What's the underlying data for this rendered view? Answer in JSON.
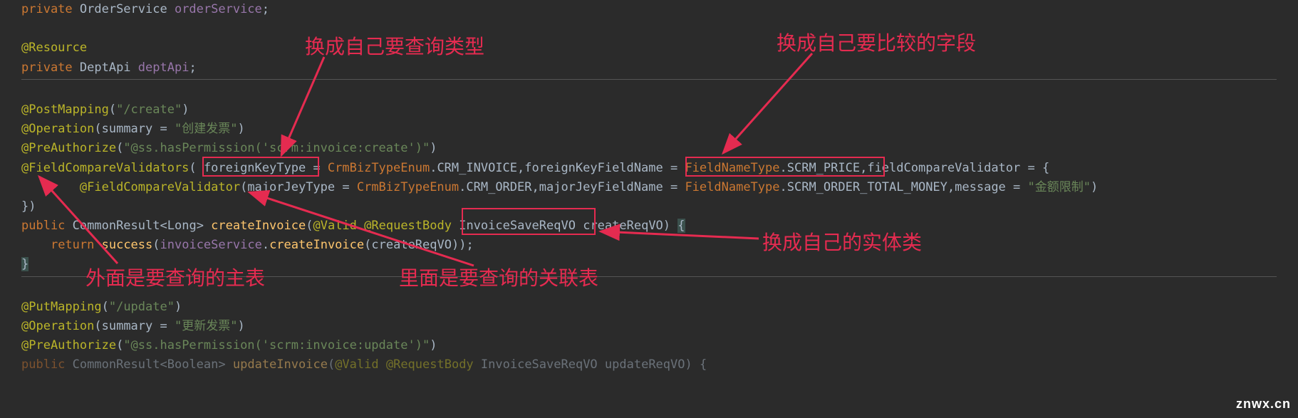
{
  "code": {
    "l1_kw_private": "private",
    "l1_type_OrderService": " OrderService ",
    "l1_field_orderService": "orderService",
    "l1_semi": ";",
    "l3_anno_Resource": "@Resource",
    "l4_kw_private": "private",
    "l4_type_DeptApi": " DeptApi ",
    "l4_field_deptApi": "deptApi",
    "l4_semi": ";",
    "l6_anno_PostMapping": "@PostMapping",
    "l6_paren_open": "(",
    "l6_str_create": "\"/create\"",
    "l6_paren_close": ")",
    "l7_anno_Operation": "@Operation",
    "l7_paren_open": "(",
    "l7_param_summary": "summary = ",
    "l7_str_summary": "\"创建发票\"",
    "l7_paren_close": ")",
    "l8_anno_PreAuthorize": "@PreAuthorize",
    "l8_paren_open": "(",
    "l8_str": "\"@ss.hasPermission('scrm:invoice:create')\"",
    "l8_paren_close": ")",
    "l9_anno_FCV": "@FieldCompareValidators",
    "l9_paren_open": "( ",
    "l9_p1_name": "foreignKeyType ",
    "l9_eq1": "= ",
    "l9_p1_enum": "CrmBizTypeEnum",
    "l9_p1_val": ".CRM_INVOICE,",
    "l9_p2_name": "foreignKeyFieldName = ",
    "l9_p2_enum": "FieldNameType",
    "l9_p2_val": ".SCRM_PRICE,",
    "l9_p3_name": "fieldCompareValidator = {",
    "l10_indent": "        ",
    "l10_anno_FCV": "@FieldCompareValidator",
    "l10_paren_open": "(",
    "l10_p1_name": "majorJeyType = ",
    "l10_p1_enum": "CrmBizTypeEnum",
    "l10_p1_val": ".CRM_ORDER,",
    "l10_p2_name": "majorJeyFieldName = ",
    "l10_p2_enum": "FieldNameType",
    "l10_p2_val": ".SCRM_ORDER_TOTAL_MONEY,",
    "l10_p3_name": "message = ",
    "l10_p3_str": "\"金额限制\"",
    "l10_paren_close": ")",
    "l11_close": "})",
    "l12_kw_public": "public ",
    "l12_type_CR": "CommonResult",
    "l12_generic_open": "<",
    "l12_type_Long": "Long",
    "l12_generic_close": "> ",
    "l12_method": "createInvoice",
    "l12_paren_open": "(",
    "l12_anno_Valid": "@Valid ",
    "l12_anno_RequestBody": "@RequestBody ",
    "l12_type_VO": "InvoiceSaveReqVO ",
    "l12_param": "createReqVO",
    "l12_paren_close": ") ",
    "l12_brace_open": "{",
    "l13_indent": "    ",
    "l13_kw_return": "return ",
    "l13_method_success": "success",
    "l13_paren_open": "(",
    "l13_field_invoiceService": "invoiceService",
    "l13_dot": ".",
    "l13_method_create": "createInvoice",
    "l13_paren_open2": "(",
    "l13_arg": "createReqVO",
    "l13_paren_close2": ")",
    "l13_paren_close": ");",
    "l14_brace_close": "}",
    "l16_anno_PutMapping": "@PutMapping",
    "l16_paren_open": "(",
    "l16_str_update": "\"/update\"",
    "l16_paren_close": ")",
    "l17_anno_Operation": "@Operation",
    "l17_paren_open": "(",
    "l17_param_summary": "summary = ",
    "l17_str_summary": "\"更新发票\"",
    "l17_paren_close": ")",
    "l18_anno_PreAuthorize": "@PreAuthorize",
    "l18_paren_open": "(",
    "l18_str": "\"@ss.hasPermission('scrm:invoice:update')\"",
    "l18_paren_close": ")",
    "l19_kw_public": "public ",
    "l19_type_CR": "CommonResult",
    "l19_generic_open": "<",
    "l19_type_Boolean": "Boolean",
    "l19_generic_close": "> ",
    "l19_method": "updateInvoice",
    "l19_paren_open": "(",
    "l19_anno_Valid": "@Valid ",
    "l19_anno_RequestBody": "@RequestBody ",
    "l19_type_VO": "InvoiceSaveReqVO ",
    "l19_param": "updateReqVO",
    "l19_paren_close": ") {"
  },
  "annotations": {
    "a1": "换成自己要查询类型",
    "a2": "换成自己要比较的字段",
    "a3": "外面是要查询的主表",
    "a4": "里面是要查询的关联表",
    "a5": "换成自己的实体类"
  },
  "watermark": "znwx.cn"
}
